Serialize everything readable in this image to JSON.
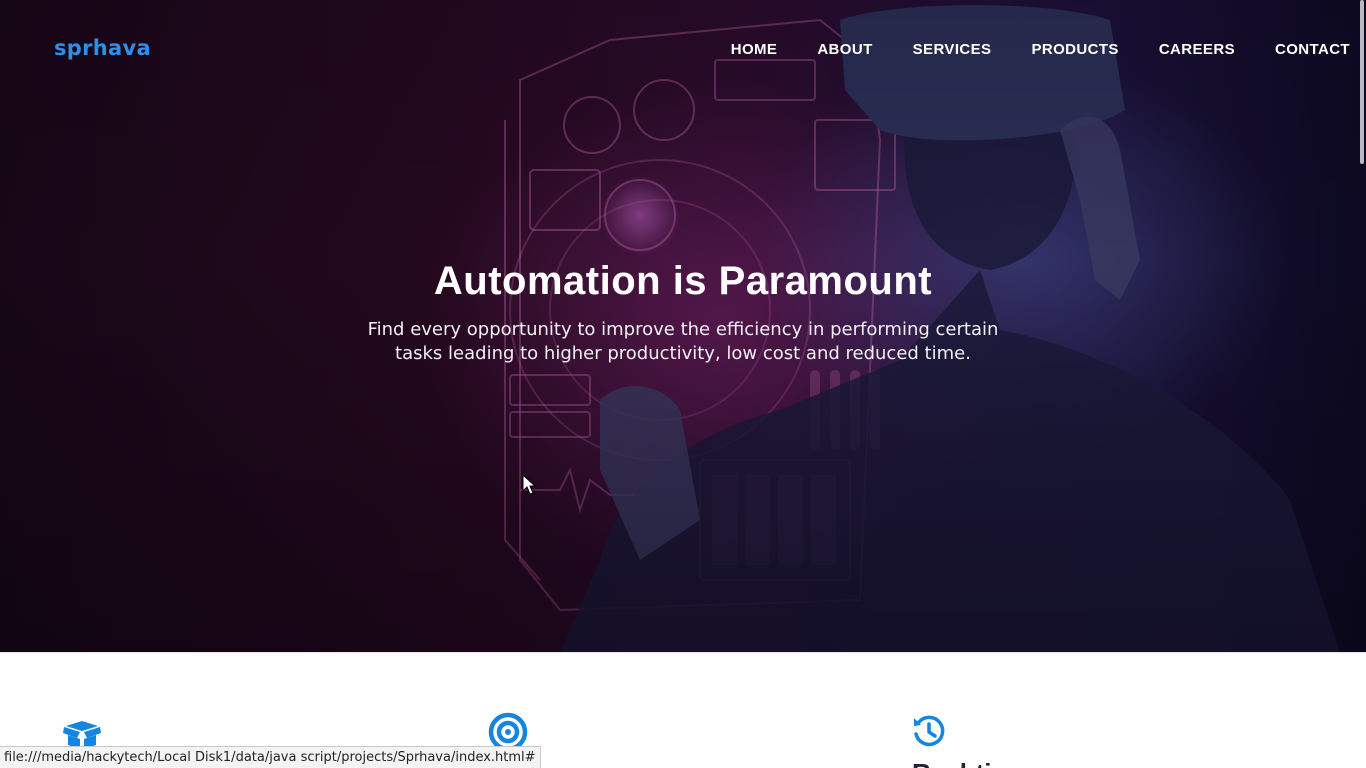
{
  "header": {
    "logo": "sprhava",
    "nav": [
      "HOME",
      "ABOUT",
      "SERVICES",
      "PRODUCTS",
      "CAREERS",
      "CONTACT"
    ]
  },
  "hero": {
    "title": "Automation is Paramount",
    "subtitle": "Find every opportunity to improve the efficiency in performing certain tasks leading to higher productivity, low cost and reduced time."
  },
  "features": {
    "icons": [
      "box-open-icon",
      "target-icon",
      "history-icon"
    ],
    "third_title": "Real-time"
  },
  "status_bar": {
    "url": "file:///media/hackytech/Local Disk1/data/java script/projects/Sprhava/index.html#"
  },
  "colors": {
    "brand": "#2f8fe8",
    "accent": "#1485e0"
  }
}
